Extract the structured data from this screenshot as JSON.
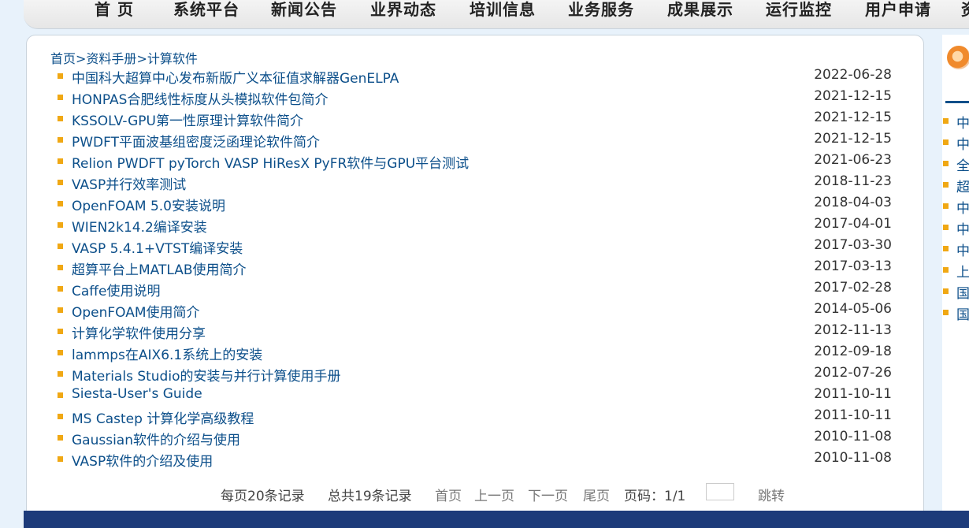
{
  "nav": {
    "items": [
      "首 页",
      "系统平台",
      "新闻公告",
      "业界动态",
      "培训信息",
      "业务服务",
      "成果展示",
      "运行监控",
      "用户申请",
      "资"
    ]
  },
  "breadcrumb": {
    "home": "首页",
    "sep": ">",
    "section": "资料手册",
    "current": "计算软件"
  },
  "articles": [
    {
      "title": "中国科大超算中心发布新版广义本征值求解器GenELPA",
      "date": "2022-06-28"
    },
    {
      "title": "HONPAS合肥线性标度从头模拟软件包简介",
      "date": "2021-12-15"
    },
    {
      "title": "KSSOLV-GPU第一性原理计算软件简介",
      "date": "2021-12-15"
    },
    {
      "title": "PWDFT平面波基组密度泛函理论软件简介",
      "date": "2021-12-15"
    },
    {
      "title": "Relion PWDFT pyTorch VASP HiResX PyFR软件与GPU平台测试",
      "date": "2021-06-23"
    },
    {
      "title": "VASP并行效率测试",
      "date": "2018-11-23"
    },
    {
      "title": "OpenFOAM 5.0安装说明",
      "date": "2018-04-03"
    },
    {
      "title": "WIEN2k14.2编译安装",
      "date": "2017-04-01"
    },
    {
      "title": "VASP 5.4.1+VTST编译安装",
      "date": "2017-03-30"
    },
    {
      "title": "超算平台上MATLAB使用简介",
      "date": "2017-03-13"
    },
    {
      "title": "Caffe使用说明",
      "date": "2017-02-28"
    },
    {
      "title": "OpenFOAM使用简介",
      "date": "2014-05-06"
    },
    {
      "title": "计算化学软件使用分享",
      "date": "2012-11-13"
    },
    {
      "title": "lammps在AIX6.1系统上的安装",
      "date": "2012-09-18"
    },
    {
      "title": "Materials Studio的安装与并行计算使用手册",
      "date": "2012-07-26"
    },
    {
      "title": "Siesta-User's Guide",
      "date": "2011-10-11"
    },
    {
      "title": "MS Castep 计算化学高级教程",
      "date": "2011-10-11"
    },
    {
      "title": "Gaussian软件的介绍与使用",
      "date": "2010-11-08"
    },
    {
      "title": "VASP软件的介绍及使用",
      "date": "2010-11-08"
    }
  ],
  "pager": {
    "per_page": "每页20条记录",
    "total": "总共19条记录",
    "first": "首页",
    "prev": "上一页",
    "next": "下一页",
    "last": "尾页",
    "page_label": "页码：1/1",
    "jump": "跳转"
  },
  "right": {
    "items": [
      "中",
      "中",
      "全",
      "超",
      "中",
      "中",
      "中",
      "上",
      "国",
      "国"
    ]
  },
  "colors": {
    "link": "#0c4f8a",
    "bullet": "#f0a814",
    "footer": "#1d3b7a",
    "page_bg": "#e8f2fb"
  }
}
